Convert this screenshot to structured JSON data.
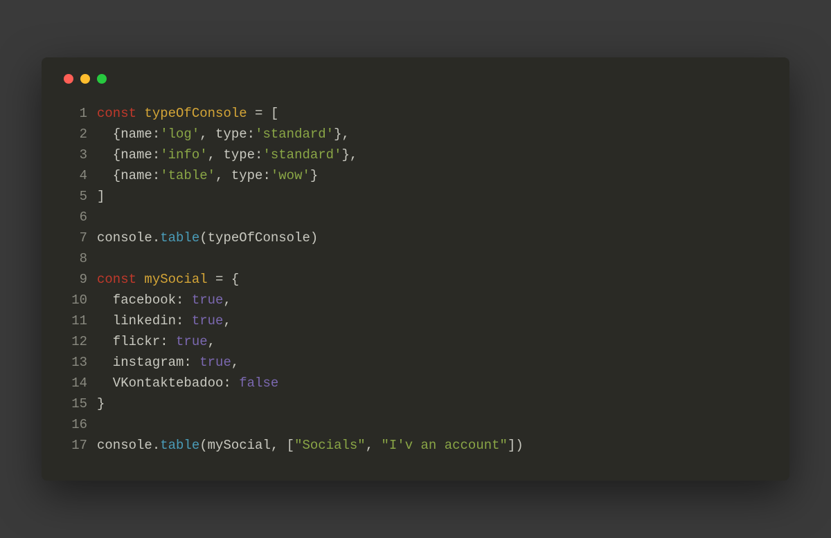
{
  "window": {
    "dots": {
      "close": "#ff5f56",
      "minimize": "#ffbd2e",
      "maximize": "#27c93f"
    }
  },
  "code": {
    "lines": [
      {
        "num": "1",
        "tokens": [
          {
            "t": "const ",
            "c": "tok-keyword"
          },
          {
            "t": "typeOfConsole",
            "c": "tok-ident"
          },
          {
            "t": " = [",
            "c": "tok-plain"
          }
        ]
      },
      {
        "num": "2",
        "tokens": [
          {
            "t": "  {name:",
            "c": "tok-plain"
          },
          {
            "t": "'log'",
            "c": "tok-string"
          },
          {
            "t": ", type:",
            "c": "tok-plain"
          },
          {
            "t": "'standard'",
            "c": "tok-string"
          },
          {
            "t": "},",
            "c": "tok-plain"
          }
        ]
      },
      {
        "num": "3",
        "tokens": [
          {
            "t": "  {name:",
            "c": "tok-plain"
          },
          {
            "t": "'info'",
            "c": "tok-string"
          },
          {
            "t": ", type:",
            "c": "tok-plain"
          },
          {
            "t": "'standard'",
            "c": "tok-string"
          },
          {
            "t": "},",
            "c": "tok-plain"
          }
        ]
      },
      {
        "num": "4",
        "tokens": [
          {
            "t": "  {name:",
            "c": "tok-plain"
          },
          {
            "t": "'table'",
            "c": "tok-string"
          },
          {
            "t": ", type:",
            "c": "tok-plain"
          },
          {
            "t": "'wow'",
            "c": "tok-string"
          },
          {
            "t": "}",
            "c": "tok-plain"
          }
        ]
      },
      {
        "num": "5",
        "tokens": [
          {
            "t": "]",
            "c": "tok-plain"
          }
        ]
      },
      {
        "num": "6",
        "tokens": []
      },
      {
        "num": "7",
        "tokens": [
          {
            "t": "console.",
            "c": "tok-plain"
          },
          {
            "t": "table",
            "c": "tok-func"
          },
          {
            "t": "(typeOfConsole)",
            "c": "tok-plain"
          }
        ]
      },
      {
        "num": "8",
        "tokens": []
      },
      {
        "num": "9",
        "tokens": [
          {
            "t": "const ",
            "c": "tok-keyword"
          },
          {
            "t": "mySocial",
            "c": "tok-ident"
          },
          {
            "t": " = {",
            "c": "tok-plain"
          }
        ]
      },
      {
        "num": "10",
        "tokens": [
          {
            "t": "  facebook: ",
            "c": "tok-plain"
          },
          {
            "t": "true",
            "c": "tok-bool"
          },
          {
            "t": ",",
            "c": "tok-plain"
          }
        ]
      },
      {
        "num": "11",
        "tokens": [
          {
            "t": "  linkedin: ",
            "c": "tok-plain"
          },
          {
            "t": "true",
            "c": "tok-bool"
          },
          {
            "t": ",",
            "c": "tok-plain"
          }
        ]
      },
      {
        "num": "12",
        "tokens": [
          {
            "t": "  flickr: ",
            "c": "tok-plain"
          },
          {
            "t": "true",
            "c": "tok-bool"
          },
          {
            "t": ",",
            "c": "tok-plain"
          }
        ]
      },
      {
        "num": "13",
        "tokens": [
          {
            "t": "  instagram: ",
            "c": "tok-plain"
          },
          {
            "t": "true",
            "c": "tok-bool"
          },
          {
            "t": ",",
            "c": "tok-plain"
          }
        ]
      },
      {
        "num": "14",
        "tokens": [
          {
            "t": "  VKontaktebadoo: ",
            "c": "tok-plain"
          },
          {
            "t": "false",
            "c": "tok-bool"
          }
        ]
      },
      {
        "num": "15",
        "tokens": [
          {
            "t": "}",
            "c": "tok-plain"
          }
        ]
      },
      {
        "num": "16",
        "tokens": []
      },
      {
        "num": "17",
        "tokens": [
          {
            "t": "console.",
            "c": "tok-plain"
          },
          {
            "t": "table",
            "c": "tok-func"
          },
          {
            "t": "(mySocial, [",
            "c": "tok-plain"
          },
          {
            "t": "\"Socials\"",
            "c": "tok-string"
          },
          {
            "t": ", ",
            "c": "tok-plain"
          },
          {
            "t": "\"I'v an account\"",
            "c": "tok-string"
          },
          {
            "t": "])",
            "c": "tok-plain"
          }
        ]
      }
    ]
  }
}
